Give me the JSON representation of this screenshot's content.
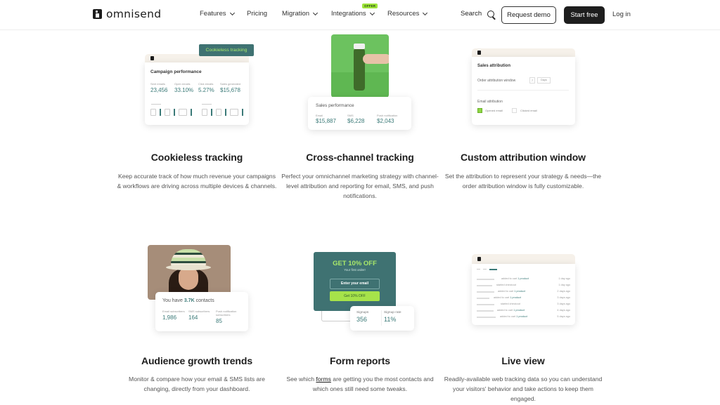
{
  "nav": {
    "brand": "omnisend",
    "items": [
      {
        "label": "Features",
        "has_dropdown": true
      },
      {
        "label": "Pricing",
        "has_dropdown": false
      },
      {
        "label": "Migration",
        "has_dropdown": true
      },
      {
        "label": "Integrations",
        "has_dropdown": true,
        "badge": "OFFER"
      },
      {
        "label": "Resources",
        "has_dropdown": true
      }
    ],
    "search_label": "Search",
    "request_demo": "Request demo",
    "start_free": "Start free",
    "log_in": "Log in"
  },
  "features": [
    {
      "title": "Cookieless tracking",
      "description": "Keep accurate track of how much revenue your campaigns & workflows are driving across multiple devices & channels.",
      "preview": {
        "tag": "Cookieless tracking",
        "card_title": "Campaign performance",
        "stats": [
          {
            "label": "Sent emails",
            "value": "23,456"
          },
          {
            "label": "Open emails",
            "value": "33.10%"
          },
          {
            "label": "Click emails",
            "value": "5.27%"
          },
          {
            "label": "Sales generated",
            "value": "$15,678"
          }
        ]
      }
    },
    {
      "title": "Cross-channel tracking",
      "description": "Perfect your omnichannel marketing strategy with channel-level attribution and reporting for email, SMS, and push notifications.",
      "preview": {
        "card_title": "Sales performance",
        "stats": [
          {
            "label": "Email",
            "value": "$15,887"
          },
          {
            "label": "SMS",
            "value": "$6,228"
          },
          {
            "label": "Push notification",
            "value": "$2,043"
          }
        ]
      }
    },
    {
      "title": "Custom attribution window",
      "description": "Set the attribution to represent your strategy & needs—the order attribution window is fully customizable.",
      "preview": {
        "card_title": "Sales attribution",
        "window_label": "Order attribution window",
        "window_value": "7",
        "window_unit": "Days",
        "email_attribution_label": "Email attribution",
        "options": [
          {
            "label": "Opened email",
            "checked": true
          },
          {
            "label": "Clicked email",
            "checked": false
          }
        ]
      }
    },
    {
      "title": "Audience growth trends",
      "description": "Monitor & compare how your email & SMS lists are changing, directly from your dashboard.",
      "preview": {
        "contacts_prefix": "You have",
        "contacts_count": "3.7K",
        "contacts_suffix": "contacts",
        "stats": [
          {
            "label": "Email subscribers",
            "value": "1,986"
          },
          {
            "label": "SMS subscribers",
            "value": "164"
          },
          {
            "label": "Push notification subscribers",
            "value": "85"
          }
        ]
      }
    },
    {
      "title": "Form reports",
      "description_before": "See which ",
      "description_link": "forms",
      "description_after": " are getting you the most contacts and which ones still need some tweaks.",
      "preview": {
        "headline": "GET 10% OFF",
        "subline": "Your first order!",
        "input_placeholder": "Enter your email",
        "button": "Get 10% OFF",
        "stats": [
          {
            "label": "Signups",
            "value": "356"
          },
          {
            "label": "Signup rate",
            "value": "11%"
          }
        ]
      }
    },
    {
      "title": "Live view",
      "description": "Readily-available web tracking data so you can understand your visitors' behavior and take actions to keep them engaged.",
      "preview": {
        "events": [
          {
            "text": "added to cart",
            "product": "1 product",
            "time": "1 day ago"
          },
          {
            "text": "started checkout",
            "product": "",
            "time": "1 day ago"
          },
          {
            "text": "added to cart",
            "product": "1 product",
            "time": "2 days ago"
          },
          {
            "text": "added to cart",
            "product": "1 product",
            "time": "3 days ago"
          },
          {
            "text": "started checkout",
            "product": "",
            "time": "3 days ago"
          },
          {
            "text": "added to cart",
            "product": "1 product",
            "time": "4 days ago"
          },
          {
            "text": "added to cart",
            "product": "1 product",
            "time": "5 days ago"
          }
        ]
      }
    }
  ]
}
